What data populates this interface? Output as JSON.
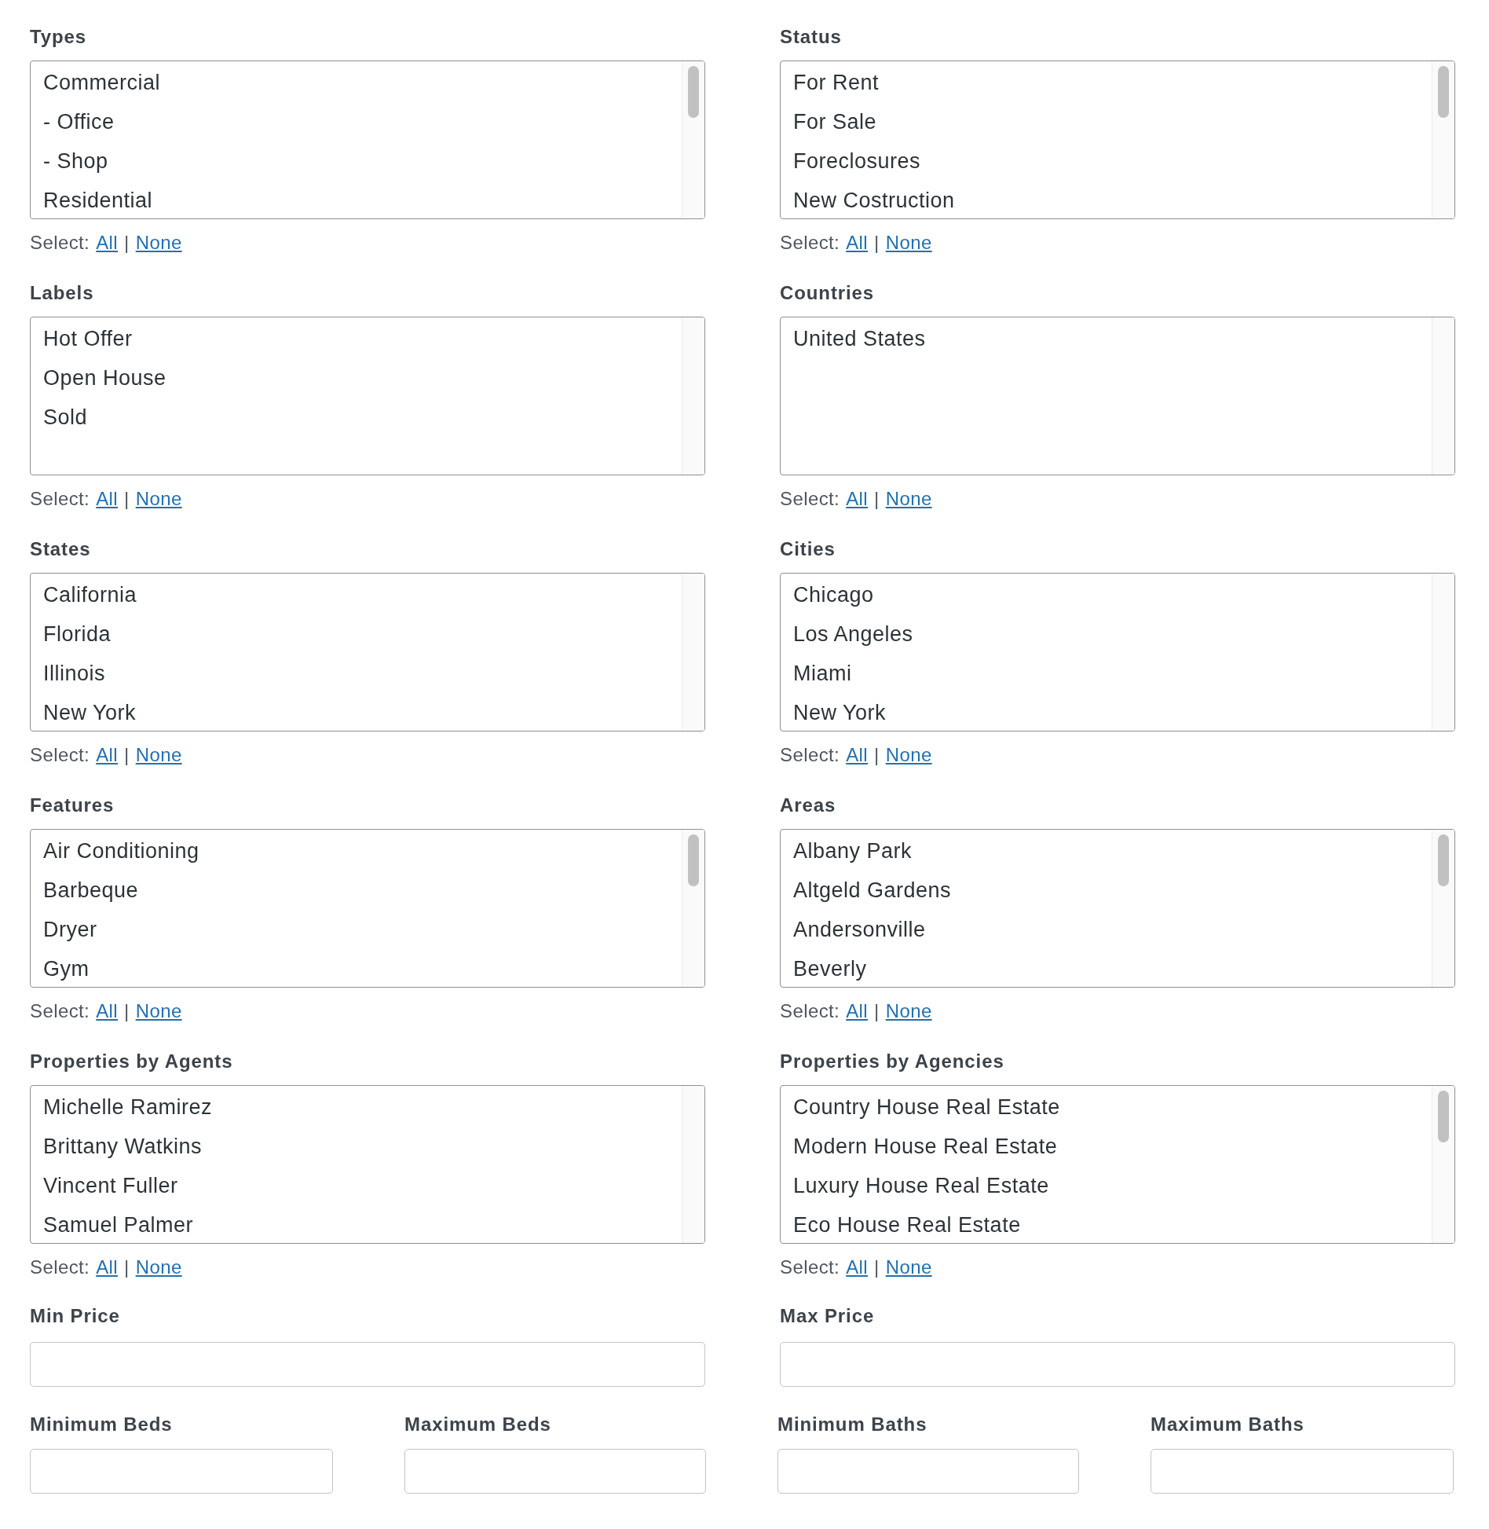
{
  "filters": [
    {
      "label": "Types",
      "scrollable": true,
      "options": [
        {
          "label": "Commercial",
          "selected": false
        },
        {
          "label": "- Office",
          "selected": false
        },
        {
          "label": "- Shop",
          "selected": false
        },
        {
          "label": "Residential",
          "selected": false
        }
      ],
      "select": {
        "prefix": "Select:",
        "all": "All",
        "separator": "|",
        "none": "None"
      }
    },
    {
      "label": "Status",
      "scrollable": true,
      "options": [
        {
          "label": "For Rent",
          "selected": false
        },
        {
          "label": "For Sale",
          "selected": false
        },
        {
          "label": "Foreclosures",
          "selected": false
        },
        {
          "label": "New Costruction",
          "selected": false
        }
      ],
      "select": {
        "prefix": "Select:",
        "all": "All",
        "separator": "|",
        "none": "None"
      }
    },
    {
      "label": "Labels",
      "scrollable": false,
      "options": [
        {
          "label": "Hot Offer",
          "selected": false
        },
        {
          "label": "Open House",
          "selected": false
        },
        {
          "label": "Sold",
          "selected": false
        }
      ],
      "select": {
        "prefix": "Select:",
        "all": "All",
        "separator": "|",
        "none": "None"
      }
    },
    {
      "label": "Countries",
      "scrollable": false,
      "options": [
        {
          "label": "United States",
          "selected": false
        }
      ],
      "select": {
        "prefix": "Select:",
        "all": "All",
        "separator": "|",
        "none": "None"
      }
    },
    {
      "label": "States",
      "scrollable": false,
      "options": [
        {
          "label": "California",
          "selected": false
        },
        {
          "label": "Florida",
          "selected": false
        },
        {
          "label": "Illinois",
          "selected": false
        },
        {
          "label": "New York",
          "selected": false
        }
      ],
      "select": {
        "prefix": "Select:",
        "all": "All",
        "separator": "|",
        "none": "None"
      }
    },
    {
      "label": "Cities",
      "scrollable": false,
      "options": [
        {
          "label": "Chicago",
          "selected": false
        },
        {
          "label": "Los Angeles",
          "selected": false
        },
        {
          "label": "Miami",
          "selected": false
        },
        {
          "label": "New York",
          "selected": false
        }
      ],
      "select": {
        "prefix": "Select:",
        "all": "All",
        "separator": "|",
        "none": "None"
      }
    },
    {
      "label": "Features",
      "scrollable": true,
      "options": [
        {
          "label": "Air Conditioning",
          "selected": false
        },
        {
          "label": "Barbeque",
          "selected": false
        },
        {
          "label": "Dryer",
          "selected": false
        },
        {
          "label": "Gym",
          "selected": false
        }
      ],
      "select": {
        "prefix": "Select:",
        "all": "All",
        "separator": "|",
        "none": "None"
      }
    },
    {
      "label": "Areas",
      "scrollable": true,
      "options": [
        {
          "label": "Albany Park",
          "selected": false
        },
        {
          "label": "Altgeld Gardens",
          "selected": false
        },
        {
          "label": "Andersonville",
          "selected": false
        },
        {
          "label": "Beverly",
          "selected": false
        }
      ],
      "select": {
        "prefix": "Select:",
        "all": "All",
        "separator": "|",
        "none": "None"
      }
    },
    {
      "label": "Properties by Agents",
      "scrollable": false,
      "options": [
        {
          "label": "Michelle Ramirez",
          "selected": false
        },
        {
          "label": "Brittany Watkins",
          "selected": false
        },
        {
          "label": "Vincent Fuller",
          "selected": false
        },
        {
          "label": "Samuel Palmer",
          "selected": false
        }
      ],
      "select": {
        "prefix": "Select:",
        "all": "All",
        "separator": "|",
        "none": "None"
      }
    },
    {
      "label": "Properties by Agencies",
      "scrollable": true,
      "options": [
        {
          "label": "Country House Real Estate",
          "selected": false
        },
        {
          "label": "Modern House Real Estate",
          "selected": false
        },
        {
          "label": "Luxury House Real Estate",
          "selected": false
        },
        {
          "label": "Eco House Real Estate",
          "selected": false
        }
      ],
      "select": {
        "prefix": "Select:",
        "all": "All",
        "separator": "|",
        "none": "None"
      }
    }
  ],
  "price_fields": [
    {
      "label": "Min Price"
    },
    {
      "label": "Max Price"
    }
  ],
  "room_fields": [
    {
      "label": "Minimum Beds"
    },
    {
      "label": "Maximum Beds"
    },
    {
      "label": "Minimum Baths"
    },
    {
      "label": "Maximum Baths"
    }
  ]
}
